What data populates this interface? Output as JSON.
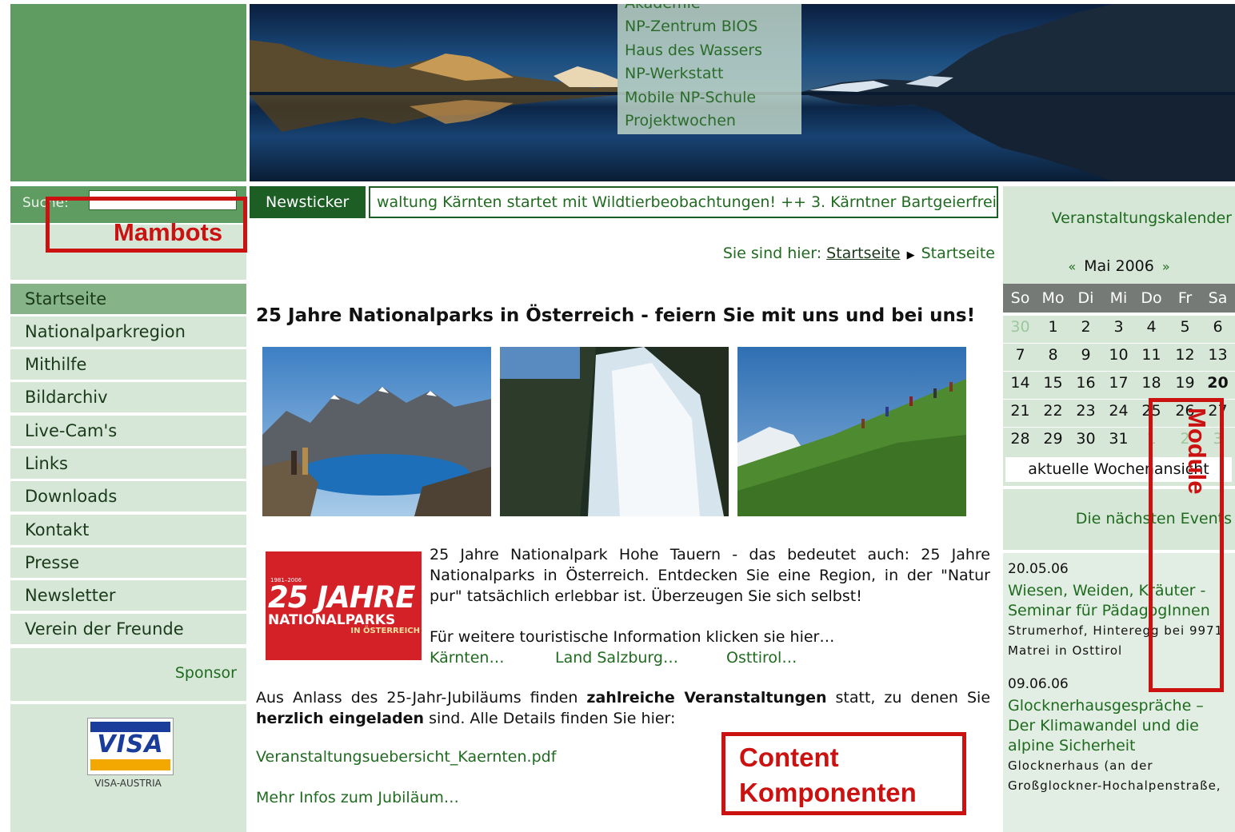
{
  "header": {
    "top_menu": [
      "Akademie",
      "NP-Zentrum BIOS",
      "Haus des Wassers",
      "NP-Werkstatt",
      "Mobile NP-Schule",
      "Projektwochen"
    ]
  },
  "search": {
    "label": "Suche:",
    "value": ""
  },
  "ticker": {
    "label": "Newsticker",
    "text": "waltung Kärnten startet mit Wildtierbeobachtungen! ++ 3. Kärntner Bartgeierfreil"
  },
  "breadcrumb": {
    "prefix": "Sie sind hier:",
    "items": [
      "Startseite",
      "Startseite"
    ]
  },
  "nav": {
    "items": [
      "Startseite",
      "Nationalparkregion",
      "Mithilfe",
      "Bildarchiv",
      "Live-Cam's",
      "Links",
      "Downloads",
      "Kontakt",
      "Presse",
      "Newsletter",
      "Verein der Freunde"
    ],
    "active": "Startseite"
  },
  "sponsor": {
    "label": "Sponsor",
    "card_text": "VISA",
    "caption": "VISA-AUSTRIA"
  },
  "content": {
    "title": "25 Jahre Nationalparks in Österreich - feiern Sie mit uns und bei uns!",
    "logo": {
      "years": "1981–2006",
      "line1": "25 JAHRE",
      "line2": "NATIONALPARKS",
      "line3": "IN ÖSTERREICH"
    },
    "intro": "25 Jahre Nationalpark Hohe Tauern - das bedeutet auch: 25 Jahre Nationalparks in Österreich. Entdecken Sie eine Region, in der \"Natur pur\" tatsächlich erlebbar ist. Überzeugen Sie sich selbst!",
    "more_info": "Für weitere touristische Information klicken sie hier…",
    "region_links": [
      "Kärnten…",
      "Land Salzburg…",
      "Osttirol…"
    ],
    "para2_a": "Aus Anlass des 25-Jahr-Jubiläums finden ",
    "para2_b": "zahlreiche Veranstaltungen",
    "para2_c": " statt, zu denen Sie ",
    "para2_d": "herzlich eingeladen",
    "para2_e": " sind. Alle Details finden Sie hier:",
    "pdf_link": "Veranstaltungsuebersicht_Kaernten.pdf",
    "mehr_link": "Mehr Infos zum Jubiläum…"
  },
  "calendar": {
    "title": "Veranstaltungskalender",
    "prev": "«",
    "month": "Mai 2006",
    "next": "»",
    "weekdays": [
      "So",
      "Mo",
      "Di",
      "Mi",
      "Do",
      "Fr",
      "Sa"
    ],
    "weeks": [
      [
        "30",
        "1",
        "2",
        "3",
        "4",
        "5",
        "6"
      ],
      [
        "7",
        "8",
        "9",
        "10",
        "11",
        "12",
        "13"
      ],
      [
        "14",
        "15",
        "16",
        "17",
        "18",
        "19",
        "20"
      ],
      [
        "21",
        "22",
        "23",
        "24",
        "25",
        "26",
        "27"
      ],
      [
        "28",
        "29",
        "30",
        "31",
        "1",
        "2",
        "3"
      ]
    ],
    "today": "20",
    "week_view": "aktuelle Wochenansicht"
  },
  "events": {
    "title": "Die nächsten Events",
    "items": [
      {
        "date": "20.05.06",
        "title": "Wiesen, Weiden, Kräuter - Seminar für PädagogInnen",
        "location": "Strumerhof, Hinteregg bei 9971 Matrei in Osttirol"
      },
      {
        "date": "09.06.06",
        "title": "Glocknerhausgespräche – Der Klimawandel und die alpine Sicherheit",
        "location": "Glocknerhaus (an der Großglockner-Hochalpenstraße,"
      }
    ]
  },
  "annotations": {
    "mambots": "Mambots",
    "content": "Content Komponenten",
    "module": "Module"
  },
  "colors": {
    "green_dark": "#1d5e25",
    "green_mid": "#5e9c61",
    "green_light": "#d6e7d7",
    "link": "#1f6b1f",
    "annotation": "#cc1111"
  }
}
